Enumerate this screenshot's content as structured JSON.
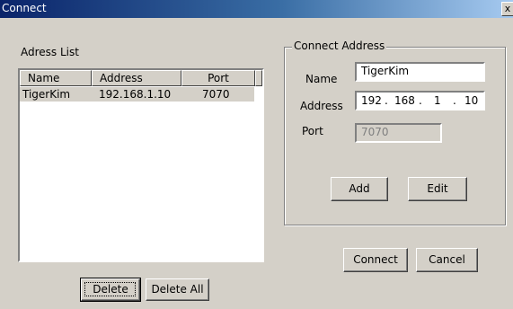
{
  "window": {
    "title": "Connect",
    "close_glyph": "x"
  },
  "address_list": {
    "label": "Adress List",
    "columns": [
      "Name",
      "Address",
      "Port"
    ],
    "rows": [
      {
        "name": "TigerKim",
        "address": "192.168.1.10",
        "port": "7070"
      }
    ]
  },
  "connect_address": {
    "legend": "Connect Address",
    "name_label": "Name",
    "name_value": "TigerKim",
    "address_label": "Address",
    "ip_octets": [
      "192",
      "168",
      "1",
      "10"
    ],
    "port_label": "Port",
    "port_value": "7070",
    "add_label": "Add",
    "edit_label": "Edit"
  },
  "buttons": {
    "delete_label": "Delete",
    "delete_all_label": "Delete All",
    "connect_label": "Connect",
    "cancel_label": "Cancel"
  }
}
